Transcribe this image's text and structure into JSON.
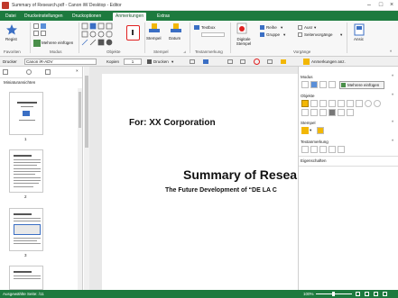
{
  "window": {
    "title": "Summary of Research.pdf - Canon iW Desktop - Editor"
  },
  "tabs": [
    "Datei",
    "Druckeinstellungen",
    "Druckoptionen",
    "Anmerkungen",
    "Extras"
  ],
  "ribbon": {
    "groups": {
      "favoriten": "Favoriten",
      "modus": "Modus",
      "objekte": "Objekte",
      "stempel": "Stempel",
      "textanmerkung": "Textanmerkung",
      "vorgaenge": "Vorgänge"
    },
    "register_label": "Regist",
    "mehrere_einfuegen": "Mehrere einfügen",
    "stempel_label": "Stempel",
    "datum_label": "Datum",
    "textbox_label": "Textbox",
    "digitale_stempel_label": "Digitale Stempel",
    "reihe_label": "Reihe",
    "gruppe_label": "Gruppe",
    "ausr_label": "Ausr",
    "seitenvorgaenge_label": "Seitenvorgänge",
    "ansic_label": "Ansic"
  },
  "toolbar": {
    "drucker_label": "Drucker",
    "printer_value": "Canon iR-ADV",
    "kopien_label": "Kopien",
    "kopien_value": "1",
    "drucken_label": "Drucken",
    "anmerkungen_anz": "Anmerkungen anz."
  },
  "left_panel": {
    "title": "Miniaturansichten",
    "thumbnails": [
      {
        "page": "1"
      },
      {
        "page": "2"
      },
      {
        "page": "3"
      }
    ]
  },
  "document": {
    "for_line": "For: XX Corporation",
    "title": "Summary of Resea",
    "subtitle": "The Future Development of “DE LA C"
  },
  "right_panel": {
    "modus_title": "Modus",
    "mehrere_einfuegen": "Mehrere einfügen",
    "objekte_title": "Objekte",
    "stempel_title": "Stempel",
    "textanmerkung_title": "Textanmerkung",
    "eigenschaften_title": "Eigenschaften"
  },
  "status": {
    "left_text": "Ausgewählte Seite: /11",
    "zoom": "100%"
  },
  "colors": {
    "ribbon_green": "#1d7a3e",
    "highlight_red": "#e02020",
    "stamp_yellow": "#f2b705"
  }
}
